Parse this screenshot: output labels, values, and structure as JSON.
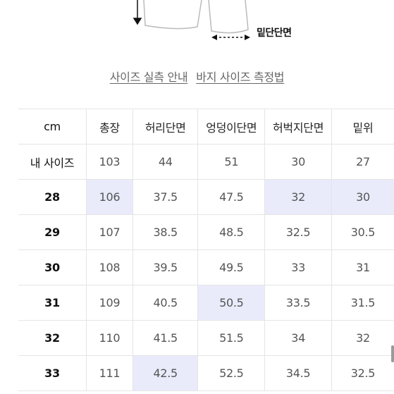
{
  "illustration": {
    "label": "밑단단면"
  },
  "links": {
    "measure_guide": "사이즈 실측 안내",
    "pants_measure": "바지 사이즈 측정법"
  },
  "table": {
    "columns": [
      "cm",
      "총장",
      "허리단면",
      "엉덩이단면",
      "허벅지단면",
      "밑위"
    ],
    "rows": [
      {
        "label": "내 사이즈",
        "cells": [
          "103",
          "44",
          "51",
          "30",
          "27"
        ]
      },
      {
        "label": "28",
        "cells": [
          "106",
          "37.5",
          "47.5",
          "32",
          "30"
        ]
      },
      {
        "label": "29",
        "cells": [
          "107",
          "38.5",
          "48.5",
          "32.5",
          "30.5"
        ]
      },
      {
        "label": "30",
        "cells": [
          "108",
          "39.5",
          "49.5",
          "33",
          "31"
        ]
      },
      {
        "label": "31",
        "cells": [
          "109",
          "40.5",
          "50.5",
          "33.5",
          "31.5"
        ]
      },
      {
        "label": "32",
        "cells": [
          "110",
          "41.5",
          "51.5",
          "34",
          "32"
        ]
      },
      {
        "label": "33",
        "cells": [
          "111",
          "42.5",
          "52.5",
          "34.5",
          "32.5"
        ]
      }
    ]
  },
  "colors": {
    "highlight": "#e9ebfb",
    "grid": "#e5e5e5",
    "link": "#666666"
  }
}
